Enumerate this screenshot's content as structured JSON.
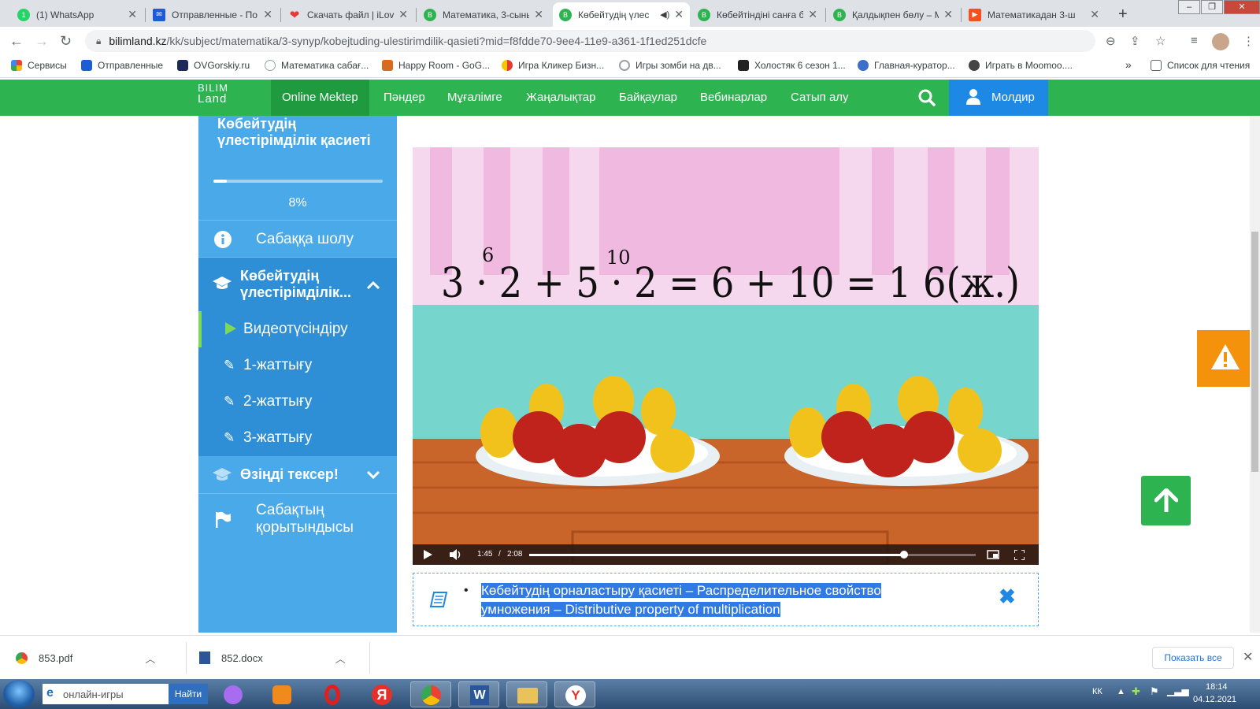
{
  "browser": {
    "tabs": [
      {
        "title": "(1) WhatsApp",
        "icon": "whatsapp-icon",
        "color": "#25d366"
      },
      {
        "title": "Отправленные - По",
        "icon": "mail-icon",
        "color": "#1e5bd6"
      },
      {
        "title": "Скачать файл | iLove",
        "icon": "heart-icon",
        "color": "#e53935"
      },
      {
        "title": "Математика, 3-сынь",
        "icon": "bilimland-icon",
        "color": "#2db34f"
      },
      {
        "title": "Көбейтудің үлес",
        "icon": "bilimland-icon",
        "color": "#2db34f",
        "active": true
      },
      {
        "title": "Көбейтіндіні санға б",
        "icon": "bilimland-icon",
        "color": "#2db34f"
      },
      {
        "title": "Қалдықпен бөлу – М",
        "icon": "bilimland-icon",
        "color": "#2db34f"
      },
      {
        "title": "Математикадан 3-ш",
        "icon": "play-icon",
        "color": "#f4511e"
      }
    ],
    "url_host": "bilimland.kz",
    "url_path": "/kk/subject/matematika/3-synyp/kobejtuding-ulestirimdilik-qasieti?mid=f8fdde70-9ee4-11e9-a361-1f1ed251dcfe",
    "bookmarks": [
      {
        "label": "Сервисы",
        "color": "#4285f4"
      },
      {
        "label": "Отправленные",
        "color": "#1e5bd6"
      },
      {
        "label": "OVGorskiy.ru",
        "color": "#1c2a5a"
      },
      {
        "label": "Математика сабағ...",
        "color": "#9aa0a6"
      },
      {
        "label": "Happy Room - GoG...",
        "color": "#d86b1f"
      },
      {
        "label": "Игра Кликер Бизн...",
        "color": "#f9c400"
      },
      {
        "label": "Игры зомби на дв...",
        "color": "#9aa0a6"
      },
      {
        "label": "Холостяк 6 сезон 1...",
        "color": "#222222"
      },
      {
        "label": "Главная-куратор...",
        "color": "#3b6fc9"
      },
      {
        "label": "Играть в Moomoo....",
        "color": "#444444"
      }
    ],
    "bookmarks_more": "»",
    "reading_list": "Список для чтения"
  },
  "site": {
    "logo_line1": "BILIM",
    "logo_line2": "Land",
    "nav": [
      "Online Mektep",
      "Пәндер",
      "Мұғалімге",
      "Жаңалықтар",
      "Байқаулар",
      "Вебинарлар",
      "Сатып алу"
    ],
    "user": "Молдир",
    "brand_color": "#2db34f",
    "user_color": "#1e88e5"
  },
  "sidebar": {
    "lesson_title": "Көбейтудің үлестірімділік қасиеті",
    "progress": 0.08,
    "progress_label": "8%",
    "overview": "Сабаққа шолу",
    "section_title": "Көбейтудің үлестірімділік...",
    "sub_items": [
      "Видеотүсіндіру",
      "1-жаттығу",
      "2-жаттығу",
      "3-жаттығу"
    ],
    "self_check": "Өзіңді тексер!",
    "summary_line1": "Сабақтың",
    "summary_line2": "қорытындысы"
  },
  "video": {
    "equation": "3 · 2 + 5 · 2 = 6 + 10 = 1 6(ж.)",
    "sup_left": "6",
    "sup_right": "10",
    "current_time": "1:45",
    "separator": "/",
    "duration": "2:08",
    "progress": 0.84
  },
  "glossary": {
    "text_line1": "Көбейтудің орналастыру қасиеті – Распределительное свойство",
    "text_line2": "умножения – Distributive property of multiplication"
  },
  "downloads": [
    {
      "name": "853.pdf",
      "icon": "chrome-icon"
    },
    {
      "name": "852.docx",
      "icon": "word-doc-icon"
    }
  ],
  "show_all": "Показать все",
  "taskbar": {
    "search_value": "онлайн-игры",
    "search_button": "Найти",
    "lang": "КК",
    "time": "18:14",
    "date": "04.12.2021"
  }
}
